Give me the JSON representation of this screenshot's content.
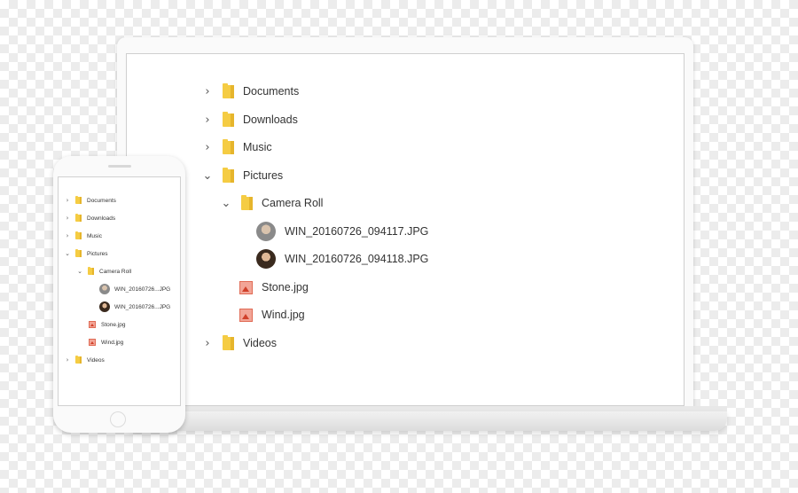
{
  "tree": {
    "documents": {
      "label": "Documents",
      "chevron": "›"
    },
    "downloads": {
      "label": "Downloads",
      "chevron": "›"
    },
    "music": {
      "label": "Music",
      "chevron": "›"
    },
    "pictures": {
      "label": "Pictures",
      "chevron": "⌄"
    },
    "camera_roll": {
      "label": "Camera Roll",
      "chevron": "⌄"
    },
    "photo1": {
      "label": "WIN_20160726_094117.JPG"
    },
    "photo2": {
      "label": "WIN_20160726_094118.JPG"
    },
    "stone": {
      "label": "Stone.jpg"
    },
    "wind": {
      "label": "Wind.jpg"
    },
    "videos": {
      "label": "Videos",
      "chevron": "›"
    }
  },
  "phone_tree": {
    "photo1": {
      "label": "WIN_20160726...JPG"
    },
    "photo2": {
      "label": "WIN_20160726...JPG"
    }
  },
  "colors": {
    "folder": "#f5cc43",
    "image_file": "#e06b55"
  },
  "icons": [
    "chevron-right-icon",
    "chevron-down-icon",
    "folder-icon",
    "image-file-icon",
    "photo-avatar-icon"
  ]
}
